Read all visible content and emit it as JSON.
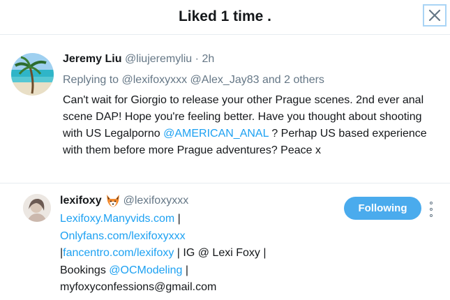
{
  "header": {
    "title": "Liked 1 time ."
  },
  "tweet": {
    "name": "Jeremy Liu",
    "handle": "@liujeremyliu",
    "dot": "·",
    "time": "2h",
    "replying_prefix": "Replying to",
    "reply_mention_1": "@lexifoxyxxx",
    "reply_mention_2": "@Alex_Jay83",
    "reply_suffix": "and 2 others",
    "text_before_link": "Can't wait for Giorgio to release your other Prague scenes. 2nd ever anal scene DAP! Hope you're feeling better. Have you thought about shooting with US Legalporno ",
    "text_link": "@AMERICAN_ANAL",
    "text_after_link": " ? Perhap US based experience with them before more Prague adventures? Peace x"
  },
  "user_card": {
    "name": "lexifoxy",
    "emoji_icon": "fox-face-icon",
    "handle": "@lexifoxyxxx",
    "follow_label": "Following",
    "bio_link_1": "Lexifoxy.Manyvids.com",
    "bio_sep_1": " |",
    "bio_link_2": "Onlyfans.com/lexifoxyxxx",
    "bio_pipe_2": "|",
    "bio_link_3": "fancentro.com/lexifoxy",
    "bio_text_3": " | IG @ Lexi Foxy |",
    "bio_text_4": "Bookings ",
    "bio_link_4": "@OCModeling",
    "bio_sep_4": " |",
    "bio_text_5": "myfoxyconfessions@gmail.com"
  },
  "colors": {
    "link": "#1da1f2",
    "muted": "#657786",
    "follow_bg": "#4aabed"
  }
}
